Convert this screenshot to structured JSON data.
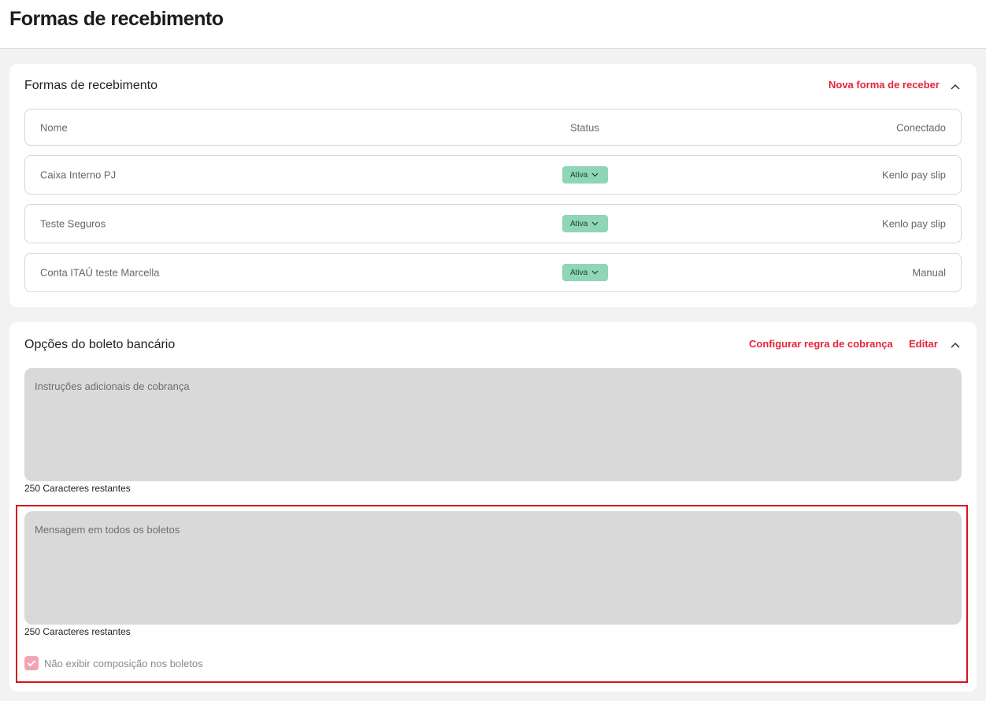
{
  "page": {
    "title": "Formas de recebimento"
  },
  "receiving_section": {
    "title": "Formas de recebimento",
    "new_link": "Nova forma de receber",
    "collapse_icon": "chevron-up-icon",
    "columns": {
      "name": "Nome",
      "status": "Status",
      "connected": "Conectado"
    },
    "rows": [
      {
        "name": "Caixa Interno PJ",
        "status": "Ativa",
        "connected": "Kenlo pay slip"
      },
      {
        "name": "Teste Seguros",
        "status": "Ativa",
        "connected": "Kenlo pay slip"
      },
      {
        "name": "Conta ITAÚ teste Marcella",
        "status": "Ativa",
        "connected": "Manual"
      }
    ],
    "status_badge_color": "#8ed6b6"
  },
  "boleto_section": {
    "title": "Opções do boleto bancário",
    "configure_link": "Configurar regra de cobrança",
    "edit_link": "Editar",
    "collapse_icon": "chevron-up-icon",
    "instructions": {
      "placeholder": "Instruções adicionais de cobrança",
      "counter": "250 Caracteres restantes"
    },
    "message": {
      "placeholder": "Mensagem em todos os boletos",
      "counter": "250 Caracteres restantes"
    },
    "checkbox": {
      "label": "Não exibir composição nos boletos",
      "checked": true,
      "icon": "check-icon"
    }
  },
  "colors": {
    "accent": "#e5233b",
    "highlight": "#d7141f"
  }
}
